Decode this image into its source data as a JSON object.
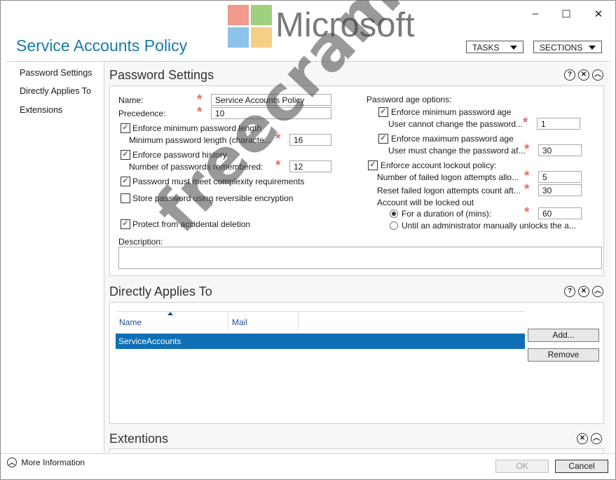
{
  "window": {
    "title": "Service Accounts Policy",
    "controls": {
      "minimize": "–",
      "maximize": "☐",
      "close": "✕"
    }
  },
  "branding": {
    "logo_text": "Microsoft",
    "logo_colors": [
      "#f25022",
      "#7fba00",
      "#00a4ef",
      "#ffb900"
    ]
  },
  "watermark": "freecram.net",
  "header": {
    "tasks_label": "TASKS",
    "sections_label": "SECTIONS"
  },
  "sidebar": {
    "items": [
      {
        "label": "Password Settings"
      },
      {
        "label": "Directly Applies To"
      },
      {
        "label": "Extensions"
      }
    ]
  },
  "password_settings": {
    "title": "Password Settings",
    "name_label": "Name:",
    "name_value": "Service Accounts Policy",
    "precedence_label": "Precedence:",
    "precedence_value": "10",
    "enforce_min_length_label": "Enforce minimum password length",
    "min_length_label": "Minimum password length (characte...",
    "min_length_value": "16",
    "enforce_history_label": "Enforce password history",
    "history_label": "Number of passwords remembered:",
    "history_value": "12",
    "complexity_label": "Password must meet complexity requirements",
    "reversible_label": "Store password using reversible encryption",
    "protect_label": "Protect from accidental deletion",
    "description_label": "Description:",
    "description_value": "",
    "age_options_label": "Password age options:",
    "enforce_min_age_label": "Enforce minimum password age",
    "min_age_label": "User cannot change the password...",
    "min_age_value": "1",
    "enforce_max_age_label": "Enforce maximum password age",
    "max_age_label": "User must change the password af...",
    "max_age_value": "30",
    "lockout_policy_label": "Enforce account lockout policy:",
    "failed_attempts_label": "Number of failed logon attempts allo...",
    "failed_attempts_value": "5",
    "reset_count_label": "Reset failed logon attempts count aft...",
    "reset_count_value": "30",
    "locked_out_label": "Account will be locked out",
    "duration_label": "For a duration of (mins):",
    "duration_value": "60",
    "until_admin_label": "Until an administrator manually unlocks the a..."
  },
  "directly_applies_to": {
    "title": "Directly Applies To",
    "columns": [
      "Name",
      "Mail"
    ],
    "rows": [
      {
        "name": "ServiceAccounts",
        "mail": ""
      }
    ],
    "add_label": "Add...",
    "remove_label": "Remove"
  },
  "extensions": {
    "title": "Extentions"
  },
  "footer": {
    "more_info_label": "More Information",
    "ok_label": "OK",
    "cancel_label": "Cancel"
  }
}
